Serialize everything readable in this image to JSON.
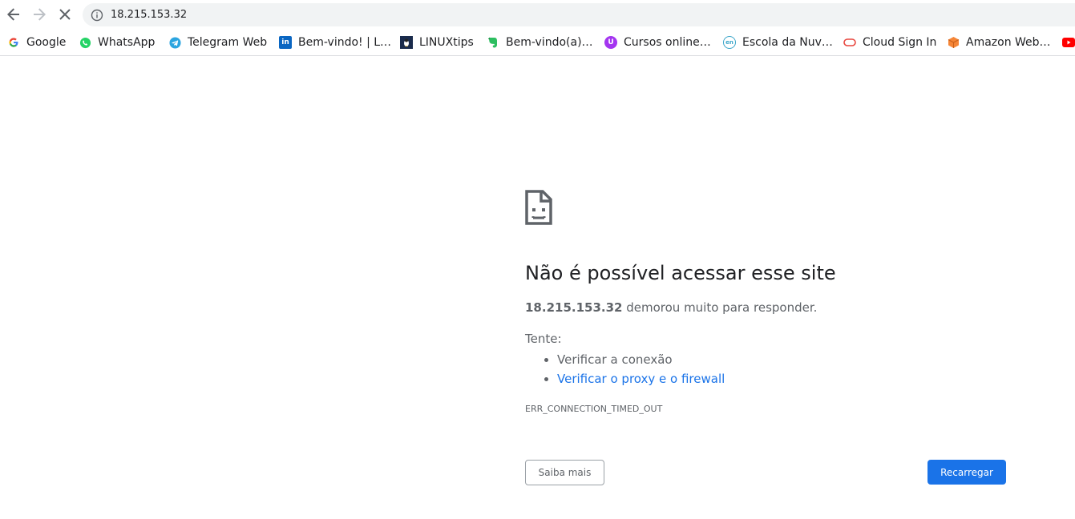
{
  "browser": {
    "url": "18.215.153.32",
    "bookmarks": [
      {
        "label": "Google",
        "icon": "google-icon",
        "color": "#4285f4"
      },
      {
        "label": "WhatsApp",
        "icon": "whatsapp-icon",
        "color": "#25d366"
      },
      {
        "label": "Telegram Web",
        "icon": "telegram-icon",
        "color": "#2ca5e0"
      },
      {
        "label": "Bem-vindo! | L…",
        "icon": "linkedin-icon",
        "color": "#0a66c2"
      },
      {
        "label": "LINUXtips",
        "icon": "linuxtips-icon",
        "color": "#1a2b4c"
      },
      {
        "label": "Bem-vindo(a)…",
        "icon": "evernote-icon",
        "color": "#2dbe60"
      },
      {
        "label": "Cursos online…",
        "icon": "udemy-icon",
        "color": "#a435f0"
      },
      {
        "label": "Escola da Nuv…",
        "icon": "escola-nuvem-icon",
        "color": "#3aa5c9"
      },
      {
        "label": "Cloud Sign In",
        "icon": "oracle-cloud-icon",
        "color": "#e8473f"
      },
      {
        "label": "Amazon Web…",
        "icon": "aws-icon",
        "color": "#f58536"
      },
      {
        "label": "",
        "icon": "youtube-icon",
        "color": "#ff0000"
      }
    ]
  },
  "error_page": {
    "title": "Não é possível acessar esse site",
    "host": "18.215.153.32",
    "description_suffix": " demorou muito para responder.",
    "try_label": "Tente:",
    "suggestions": [
      {
        "text": "Verificar a conexão",
        "link": false
      },
      {
        "text": "Verificar o proxy e o firewall",
        "link": true
      }
    ],
    "error_code": "ERR_CONNECTION_TIMED_OUT",
    "details_button": "Saiba mais",
    "reload_button": "Recarregar"
  }
}
